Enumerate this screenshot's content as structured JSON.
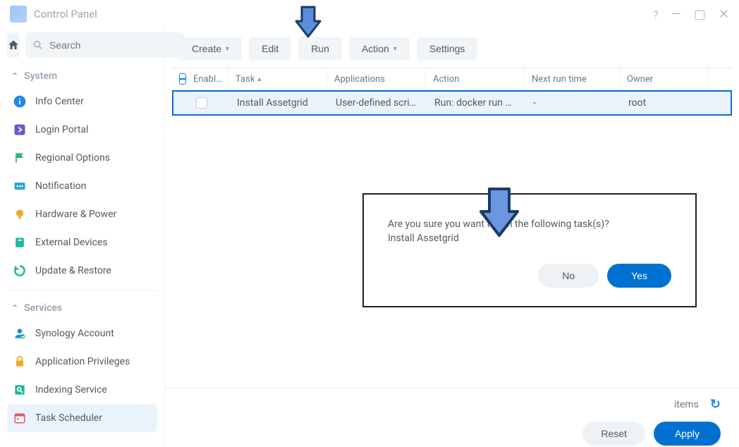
{
  "window": {
    "title": "Control Panel"
  },
  "sidebar": {
    "search_placeholder": "Search",
    "section_system": "System",
    "section_services": "Services",
    "items_system": [
      {
        "label": "Info Center",
        "icon": "info"
      },
      {
        "label": "Login Portal",
        "icon": "portal"
      },
      {
        "label": "Regional Options",
        "icon": "flag"
      },
      {
        "label": "Notification",
        "icon": "notif"
      },
      {
        "label": "Hardware & Power",
        "icon": "bulb"
      },
      {
        "label": "External Devices",
        "icon": "ext"
      },
      {
        "label": "Update & Restore",
        "icon": "update"
      }
    ],
    "items_services": [
      {
        "label": "Synology Account",
        "icon": "account"
      },
      {
        "label": "Application Privileges",
        "icon": "lock"
      },
      {
        "label": "Indexing Service",
        "icon": "index"
      },
      {
        "label": "Task Scheduler",
        "icon": "calendar",
        "active": true
      }
    ]
  },
  "toolbar": {
    "create": "Create",
    "edit": "Edit",
    "run": "Run",
    "action": "Action",
    "settings": "Settings"
  },
  "table": {
    "headers": {
      "enabled": "Enabl…",
      "task": "Task",
      "applications": "Applications",
      "action": "Action",
      "next_run": "Next run time",
      "owner": "Owner"
    },
    "rows": [
      {
        "task": "Install Assetgrid",
        "applications": "User-defined scri…",
        "action": "Run: docker run …",
        "next_run": "-",
        "owner": "root"
      }
    ]
  },
  "dialog": {
    "message": "Are you sure you want to run the following task(s)?",
    "task_name": "Install Assetgrid",
    "no": "No",
    "yes": "Yes"
  },
  "footer": {
    "items": "items",
    "reset": "Reset",
    "apply": "Apply"
  },
  "colors": {
    "accent": "#0071d1",
    "row_highlight": "#0a6ed1"
  }
}
